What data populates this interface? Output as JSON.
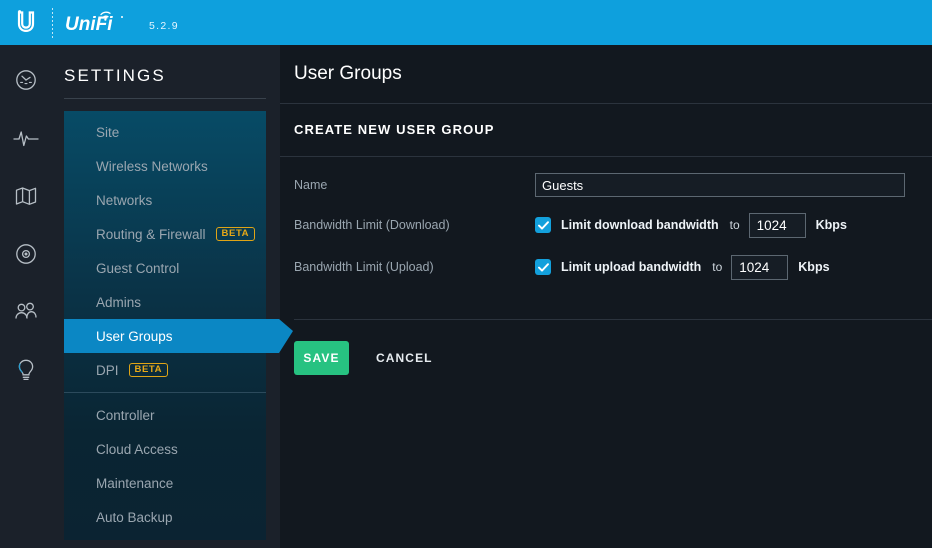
{
  "topbar": {
    "brand_logo": "ubiquiti-u-logo",
    "product": "UniFi",
    "version": "5.2.9",
    "accent_color": "#0ea0dd"
  },
  "rail": {
    "items": [
      {
        "icon": "dashboard-gauge-icon",
        "name": "dashboard"
      },
      {
        "icon": "statistics-pulse-icon",
        "name": "statistics"
      },
      {
        "icon": "map-icon",
        "name": "map"
      },
      {
        "icon": "devices-target-icon",
        "name": "devices"
      },
      {
        "icon": "clients-people-icon",
        "name": "clients"
      },
      {
        "icon": "insights-bulb-icon",
        "name": "insights"
      }
    ]
  },
  "sidebar": {
    "title": "SETTINGS",
    "items": [
      {
        "label": "Site",
        "badge": null,
        "active": false
      },
      {
        "label": "Wireless Networks",
        "badge": null,
        "active": false
      },
      {
        "label": "Networks",
        "badge": null,
        "active": false
      },
      {
        "label": "Routing & Firewall",
        "badge": "BETA",
        "active": false
      },
      {
        "label": "Guest Control",
        "badge": null,
        "active": false
      },
      {
        "label": "Admins",
        "badge": null,
        "active": false
      },
      {
        "label": "User Groups",
        "badge": null,
        "active": true
      },
      {
        "label": "DPI",
        "badge": "BETA",
        "active": false
      },
      {
        "label": "Controller",
        "badge": null,
        "active": false
      },
      {
        "label": "Cloud Access",
        "badge": null,
        "active": false
      },
      {
        "label": "Maintenance",
        "badge": null,
        "active": false
      },
      {
        "label": "Auto Backup",
        "badge": null,
        "active": false
      }
    ],
    "active_color": "#0b87c4",
    "badge_color": "#e6a817"
  },
  "main": {
    "page_title": "User Groups",
    "section_title": "CREATE NEW USER GROUP",
    "name_label": "Name",
    "name_value": "Guests",
    "name_placeholder": "",
    "download": {
      "label": "Bandwidth Limit (Download)",
      "checkbox_label": "Limit download bandwidth",
      "checked": true,
      "to_word": "to",
      "value": "1024",
      "unit": "Kbps"
    },
    "upload": {
      "label": "Bandwidth Limit (Upload)",
      "checkbox_label": "Limit upload bandwidth",
      "checked": true,
      "to_word": "to",
      "value": "1024",
      "unit": "Kbps"
    },
    "save_label": "SAVE",
    "cancel_label": "CANCEL",
    "save_color": "#27c281",
    "checkbox_color": "#13a0dc"
  }
}
